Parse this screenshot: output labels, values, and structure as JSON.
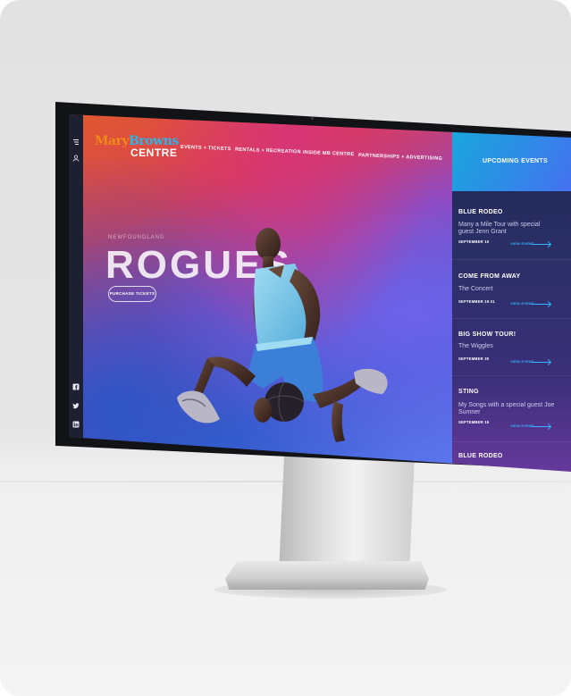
{
  "logo": {
    "line1_a": "Mary",
    "line1_b": "Browns",
    "line2": "CENTRE"
  },
  "nav": {
    "events": "EVENTS + TICKETS",
    "rentals": "RENTALS + RECREATION",
    "inside": "INSIDE MB CENTRE",
    "partnerships": "PARTNERSHIPS + ADVERTISING"
  },
  "hero": {
    "eyebrow": "NEWFOUNDLAND",
    "title": "ROGUES",
    "cta": "PURCHASE TICKETS"
  },
  "rail_icons": [
    "menu-icon",
    "user-icon",
    "facebook-icon",
    "twitter-icon",
    "linkedin-icon"
  ],
  "sidebar": {
    "heading": "UPCOMING EVENTS",
    "view_label": "VIEW EVENT",
    "events": [
      {
        "title": "BLUE RODEO",
        "subtitle": "Many a Mile Tour with special guest Jenn Grant",
        "date": "SEPTEMBER 10"
      },
      {
        "title": "COME FROM AWAY",
        "subtitle": "The Concert",
        "date": "SEPTEMBER 19-21"
      },
      {
        "title": "BIG SHOW TOUR!",
        "subtitle": "The Wiggles",
        "date": "SEPTEMBER 30"
      },
      {
        "title": "STING",
        "subtitle": "My Songs with a special guest Joe Sumner",
        "date": "SEPTEMBER 15"
      },
      {
        "title": "BLUE RODEO",
        "subtitle": "",
        "date": ""
      }
    ]
  },
  "colors": {
    "accent_blue": "#2bb4e9",
    "logo_orange": "#f08a1a",
    "link_blue": "#36b3ff",
    "sidebar_header": "#2c8ee6"
  }
}
